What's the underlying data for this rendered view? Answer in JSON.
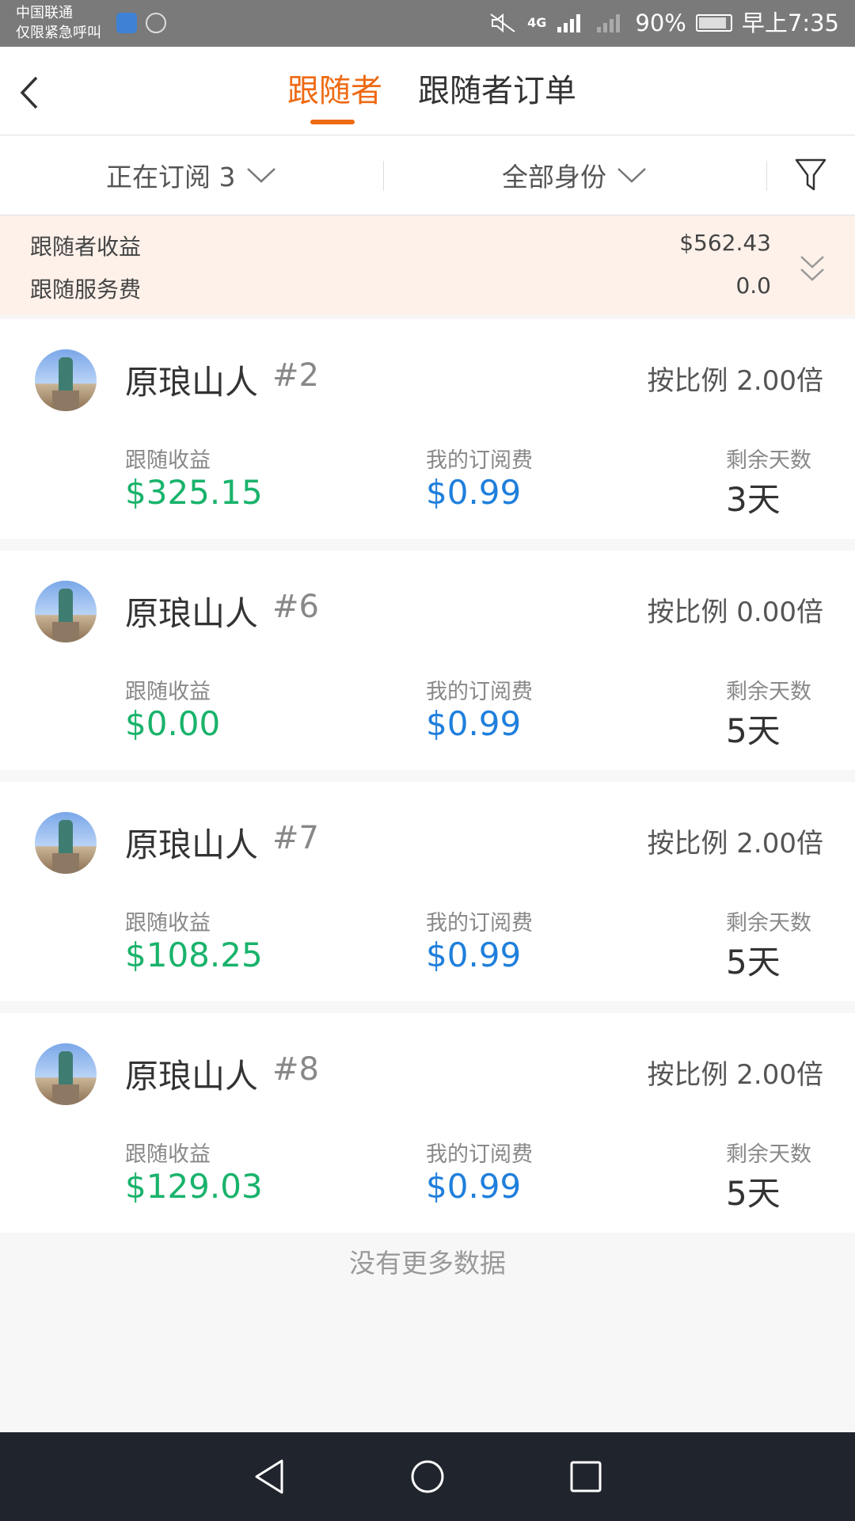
{
  "status_bar": {
    "carrier": "中国联通",
    "emergency": "仅限紧急呼叫",
    "network": "4G",
    "battery": "90%",
    "time": "早上7:35"
  },
  "header": {
    "tabs": [
      {
        "label": "跟随者",
        "active": true
      },
      {
        "label": "跟随者订单",
        "active": false
      }
    ]
  },
  "filters": {
    "subscribing": "正在订阅 3",
    "identity": "全部身份"
  },
  "summary": {
    "earnings_label": "跟随者收益",
    "earnings_value": "$562.43",
    "fee_label": "跟随服务费",
    "fee_value": "0.0"
  },
  "labels": {
    "follow_earnings": "跟随收益",
    "my_fee": "我的订阅费",
    "days_left": "剩余天数"
  },
  "followers": [
    {
      "name": "原琅山人",
      "number": "#2",
      "ratio": "按比例 2.00倍",
      "earnings": "$325.15",
      "fee": "$0.99",
      "days": "3天"
    },
    {
      "name": "原琅山人",
      "number": "#6",
      "ratio": "按比例 0.00倍",
      "earnings": "$0.00",
      "fee": "$0.99",
      "days": "5天"
    },
    {
      "name": "原琅山人",
      "number": "#7",
      "ratio": "按比例 2.00倍",
      "earnings": "$108.25",
      "fee": "$0.99",
      "days": "5天"
    },
    {
      "name": "原琅山人",
      "number": "#8",
      "ratio": "按比例 2.00倍",
      "earnings": "$129.03",
      "fee": "$0.99",
      "days": "5天"
    }
  ],
  "footer_text": "没有更多数据",
  "colors": {
    "accent": "#ee6a13",
    "earnings_green": "#19b36b",
    "fee_blue": "#1f7fdc",
    "summary_bg": "#fdf1ea"
  }
}
